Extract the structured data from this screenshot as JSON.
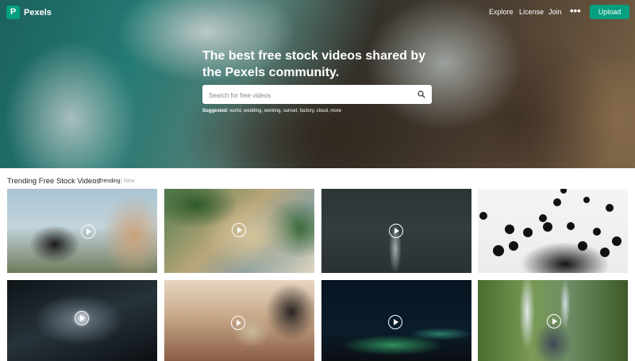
{
  "brand": {
    "name": "Pexels",
    "accent": "#05a081"
  },
  "nav": {
    "explore": "Explore",
    "license": "License",
    "join": "Join",
    "more": "•••",
    "upload": "Upload"
  },
  "hero": {
    "headline": "The best free stock videos shared by the Pexels community.",
    "search_placeholder": "Search for free videos",
    "suggested_label": "Suggested:",
    "suggested_terms": "world, wedding, working, sunset, factory, cloud, more"
  },
  "section": {
    "title": "Trending Free Stock Videos",
    "tab_trending": "Trending",
    "tab_new": "| New"
  },
  "icons": {
    "search": "search-icon",
    "play": "play-icon",
    "logo": "pexels-logo-icon"
  }
}
